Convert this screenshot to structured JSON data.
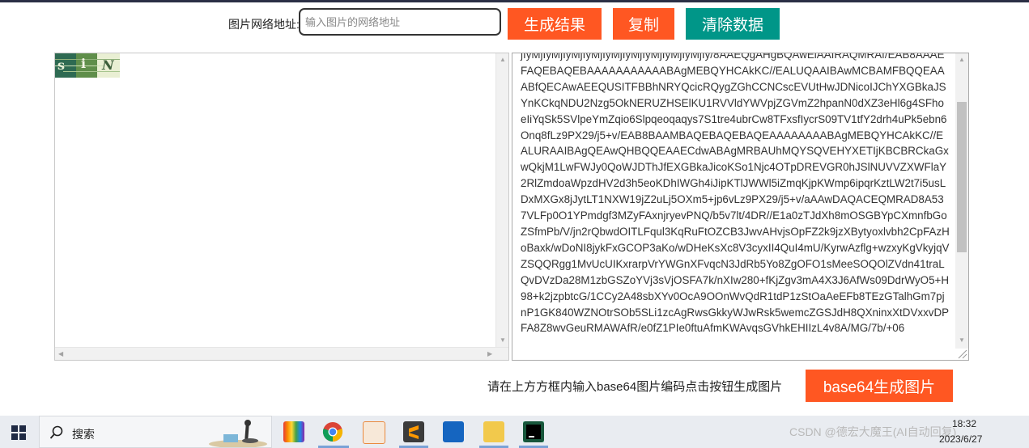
{
  "toolbar": {
    "url_label": "图片网络地址:",
    "url_placeholder": "输入图片的网络地址",
    "generate_label": "生成结果",
    "copy_label": "复制",
    "clear_label": "清除数据"
  },
  "captcha": {
    "chars": [
      "s",
      "i",
      "N"
    ]
  },
  "base64_text": "jIyMjIyMjIyMjIyMjIyMjIyMjIyMjIyMjIyMjIy/8AAEQgAHgBQAwEiAAIRAQMRAf/EAB8AAAEFAQEBAQEBAAAAAAAAAAABAgMEBQYHCAkKC//EALUQAAIBAwMCBAMFBQQEAAABfQECAwAEEQUSITFBBhNRYQcicRQygZGhCCNCscEVUtHwJDNicoIJChYXGBkaJSYnKCkqNDU2Nzg5OkNERUZHSElKU1RVVldYWVpjZGVmZ2hpanN0dXZ3eHl6g4SFhoeIiYqSk5SVlpeYmZqio6Slpqeoqaqys7S1tre4ubrCw8TFxsfIycrS09TV1tfY2drh4uPk5ebn6Onq8fLz9PX29/j5+v/EAB8BAAMBAQEBAQEBAQEAAAAAAAABAgMEBQYHCAkKC//EALURAAIBAgQEAwQHBQQEAAECdwABAgMRBAUhMQYSQVEHYXETIjKBCBRCkaGxwQkjM1LwFWJy0QoWJDThJfEXGBkaJicoKSo1Njc4OTpDREVGR0hJSlNUVVZXWFlaY2RlZmdoaWpzdHV2d3h5eoKDhIWGh4iJipKTlJWWl5iZmqKjpKWmp6ipqrKztLW2t7i5usLDxMXGx8jJytLT1NXW19jZ2uLj5OXm5+jp6vLz9PX29/j5+v/aAAwDAQACEQMRAD8A537VLFp0O1YPmdgf3MZyFAxnjryevPNQ/b5v7lt/4DR//E1a0zTJdXh8mOSGBYpCXmnfbGoZSfmPb/V/jn2rQbwdOITLFqul3KqRuFtOZCB3JwvAHvjsOpFZ2k9jzXBytyoxlvbh2CpFAzHoBaxk/wDoNI8jykFxGCOP3aKo/wDHeKsXc8V3cyxII4QuI4mU/KyrwAzflg+wzxyKgVkyjqVZSQQRgg1MvUcUIKxrarpVrYWGnXFvqcN3JdRb5Yo8ZgOFO1sMeeSOQOlZVdn41traLQvDVzDa28M1zbGSZoYVj3sVjOSFA7k/nXIw280+fKjZgv3mA4X3J6AfWs09DdrWyO5+H98+k2jzpbtcG/1CCy2A48sbXYv0OcA9OOnWvQdR1tdP1zStOaAeEFb8TEzGTalhGm7pjnP1GK840WZNOtrSOb5SLi1zcAgRwsGkkyWJwRsk5wemcZGSJdH8QXninxXtDVxxvDPFA8Z8wvGeuRMAWAfR/e0fZ1PIe0ftuAfmKWAvqsGVhkEHIIzL4v8A/MG/7b/+06",
  "hint": "请在上方方框内输入base64图片编码点击按钮生成图片",
  "b64_button_label": "base64生成图片",
  "taskbar": {
    "search_label": "搜索",
    "watermark": "CSDN @德宏大魔王(AI自动回复)",
    "time": "18:32",
    "date": "2023/6/27"
  }
}
